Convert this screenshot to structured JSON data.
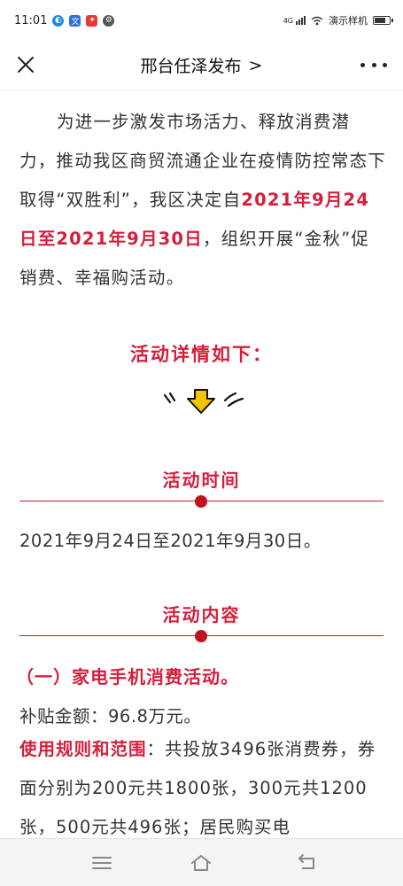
{
  "status_bar": {
    "time": "11:01",
    "network": "4G",
    "carrier": "演示样机",
    "battery_level": 0.8
  },
  "nav": {
    "title": "邢台任泽发布",
    "title_chevron": ">"
  },
  "article": {
    "intro_1": "为进一步激发市场活力、释放消费潜力，推动我区商贸流通企业在疫情防控常态下取得“双胜利”，我区决定自",
    "intro_highlight": "2021年9月24日至2021年9月30日",
    "intro_2": "，组织开展“金秋”促销费、幸福购活动。",
    "details_title": "活动详情如下：",
    "section_time_title": "活动时间",
    "time_text": "2021年9月24日至2021年9月30日。",
    "section_content_title": "活动内容",
    "sub_title_1": "（一）家电手机消费活动。",
    "subsidy_text": "补贴金额：96.8万元。",
    "rules_label": "使用规则和范围",
    "rules_text": "：共投放3496张消费券，券面分别为200元共1800张，300元共1200张，500元共496张；居民购买电"
  },
  "colors": {
    "accent": "#d51f3b",
    "divider": "#c81e2c",
    "arrow": "#f5c400"
  },
  "icons": {
    "close": "close-icon",
    "more": "more-icon",
    "menu": "menu-icon",
    "home": "home-icon",
    "back": "back-icon"
  }
}
